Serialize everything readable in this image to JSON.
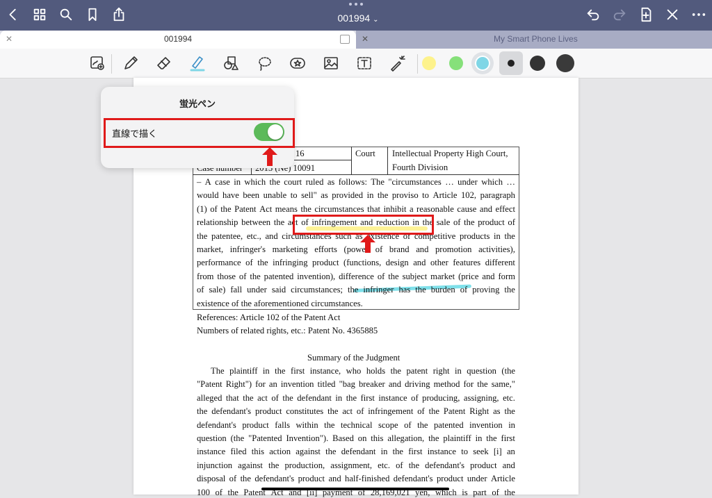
{
  "topbar": {
    "title": "001994",
    "icons": [
      "chevron-left-icon",
      "grid-icon",
      "search-icon",
      "bookmark-icon",
      "share-icon",
      "undo-icon",
      "redo-icon",
      "add-page-icon",
      "close-icon",
      "more-icon"
    ]
  },
  "tabs": [
    {
      "label": "001994",
      "active": true
    },
    {
      "label": "My Smart Phone Lives",
      "active": false
    }
  ],
  "toolbar": {
    "tools": [
      "zoom-window-icon",
      "pen-icon",
      "eraser-icon",
      "highlighter-icon",
      "shapes-icon",
      "lasso-icon",
      "sticker-icon",
      "image-icon",
      "text-icon",
      "laser-pointer-icon"
    ],
    "colors": [
      "#fdf28c",
      "#86e07a",
      "#7fd6e6",
      "#222222",
      "#333333",
      "#3a3a3a"
    ]
  },
  "popover": {
    "title": "蛍光ペン",
    "option_label": "直線で描く",
    "toggle_on": true,
    "toggle_color": "#5cba5a"
  },
  "document": {
    "table": {
      "row1_num": "16",
      "case_label": "Case number",
      "case_value": "2015 (Ne) 10091",
      "court_label": "Court",
      "court_value_1": "Intellectual Property High Court,",
      "court_value_2": "Fourth Division"
    },
    "summary_lines": [
      "– A case in which the court ruled as follows: The \"circumstances … under which …",
      "would have been unable to sell\" as provided in the proviso to Article 102, paragraph",
      "(1) of the Patent Act means the circumstances that inhibit a reasonable cause and effect",
      "relationship between the act of infringement and reduction in the sale of the product of",
      "the patentee, etc., and circumstances such as existence of competitive products in the",
      "market, infringer's marketing efforts (power of brand and promotion activities),",
      "performance of the infringing product (functions, design and other features different",
      "from those of the patented invention), difference of the subject market (price and form",
      "of sale) fall under said circumstances; the infringer has the burden of proving the",
      "existence of the aforementioned circumstances."
    ],
    "references": "References: Article 102 of the Patent Act",
    "related_rights": "Numbers of related rights, etc.: Patent No. 4365885",
    "heading": "Summary of the Judgment",
    "body_lines": [
      "The plaintiff in the first instance, who holds the patent right in question (the",
      "\"Patent Right\") for an invention titled \"bag breaker and driving method for the same,\"",
      "alleged that the act of the defendant in the first instance of producing, assigning, etc.",
      "the defendant's product constitutes the act of infringement of the Patent Right as the",
      "defendant's product falls within the technical scope of the patented invention in",
      "question (the \"Patented Invention\"). Based on this allegation, the plaintiff in the first",
      "instance filed this action against the defendant in the first instance to seek [i] an",
      "injunction against the production, assignment, etc. of the defendant's product and",
      "disposal of the defendant's product and half-finished defendant's product under Article",
      "100 of the Patent Act and [ii] payment of 28,169,021 yen, which is part of the"
    ]
  }
}
